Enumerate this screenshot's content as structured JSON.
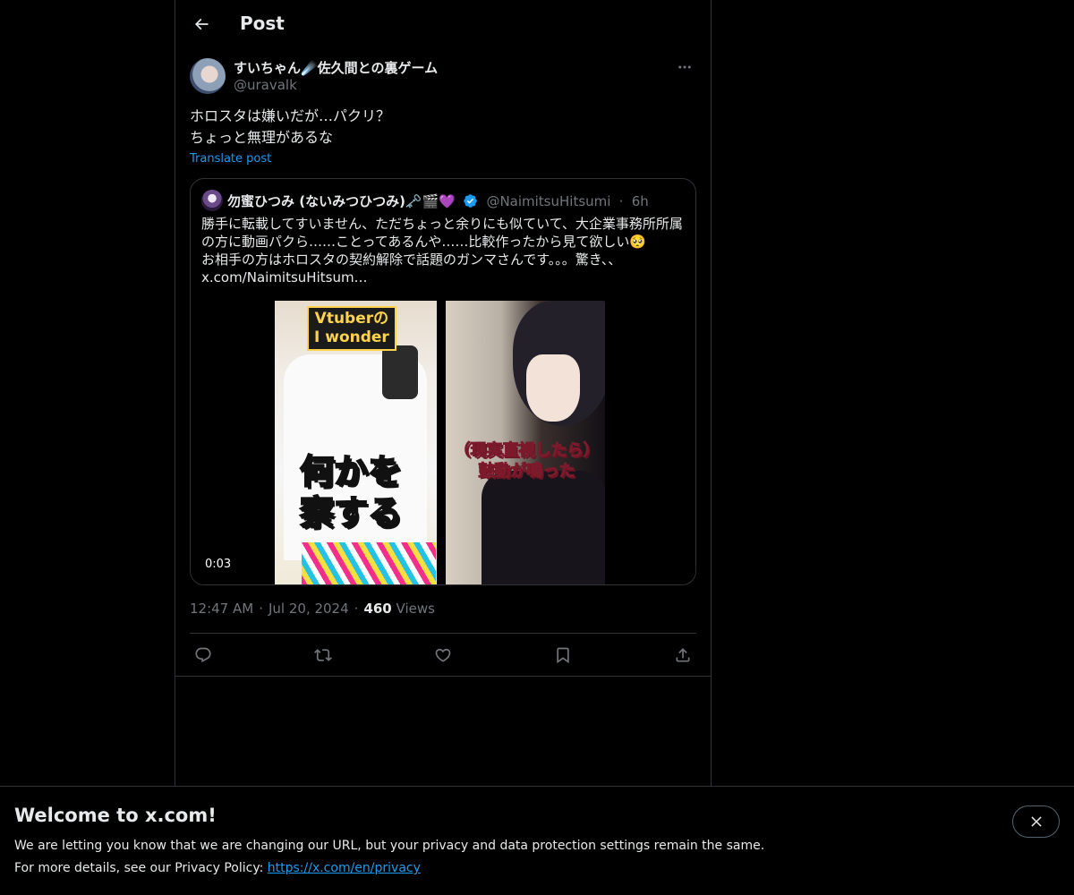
{
  "header": {
    "title": "Post"
  },
  "post": {
    "author_name": "すいちゃん☄️佐久間との裏ゲーム",
    "author_handle": "@uravalk",
    "text_lines": [
      "ホロスタは嫌いだが…パクリ？",
      "ちょっと無理があるな"
    ],
    "translate_label": "Translate post",
    "time": "12:47 AM",
    "date": "Jul 20, 2024",
    "views_count": "460",
    "views_label": "Views"
  },
  "quote": {
    "author_name": "勿蜜ひつみ (ないみつひつみ)🗝️🎬💜",
    "author_handle": "@NaimitsuHitsumi",
    "age": "6h",
    "text_lines": [
      "勝手に転載してすいません、ただちょっと余りにも似ていて、大企業事務所所属",
      "の方に動画パクら……ことってあるんや……比較作ったから見て欲しい🥺",
      "お相手の方はホロスタの契約解除で話題のガンマさんです。。。驚き、、",
      "x.com/NaimitsuHitsum…"
    ],
    "video": {
      "timer": "0:03",
      "left_badge_line1": "Vtuberの",
      "left_badge_line2": "I wonder",
      "left_caption_line1": "何かを",
      "left_caption_line2": "察する",
      "right_caption_line1": "（現実直視したら）",
      "right_caption_line2": "鼓動が鳴った"
    }
  },
  "actions": {
    "reply": "reply-icon",
    "repost": "repost-icon",
    "like": "heart-icon",
    "bookmark": "bookmark-icon",
    "share": "share-icon"
  },
  "banner": {
    "title": "Welcome to x.com!",
    "line1": "We are letting you know that we are changing our URL, but your privacy and data protection settings remain the same.",
    "line2_prefix": "For more details, see our Privacy Policy: ",
    "link": "https://x.com/en/privacy"
  },
  "colors": {
    "accent": "#1d9bf0",
    "text": "#e7e9ea",
    "muted": "#71767b",
    "border": "#2f3336",
    "background": "#000000"
  }
}
